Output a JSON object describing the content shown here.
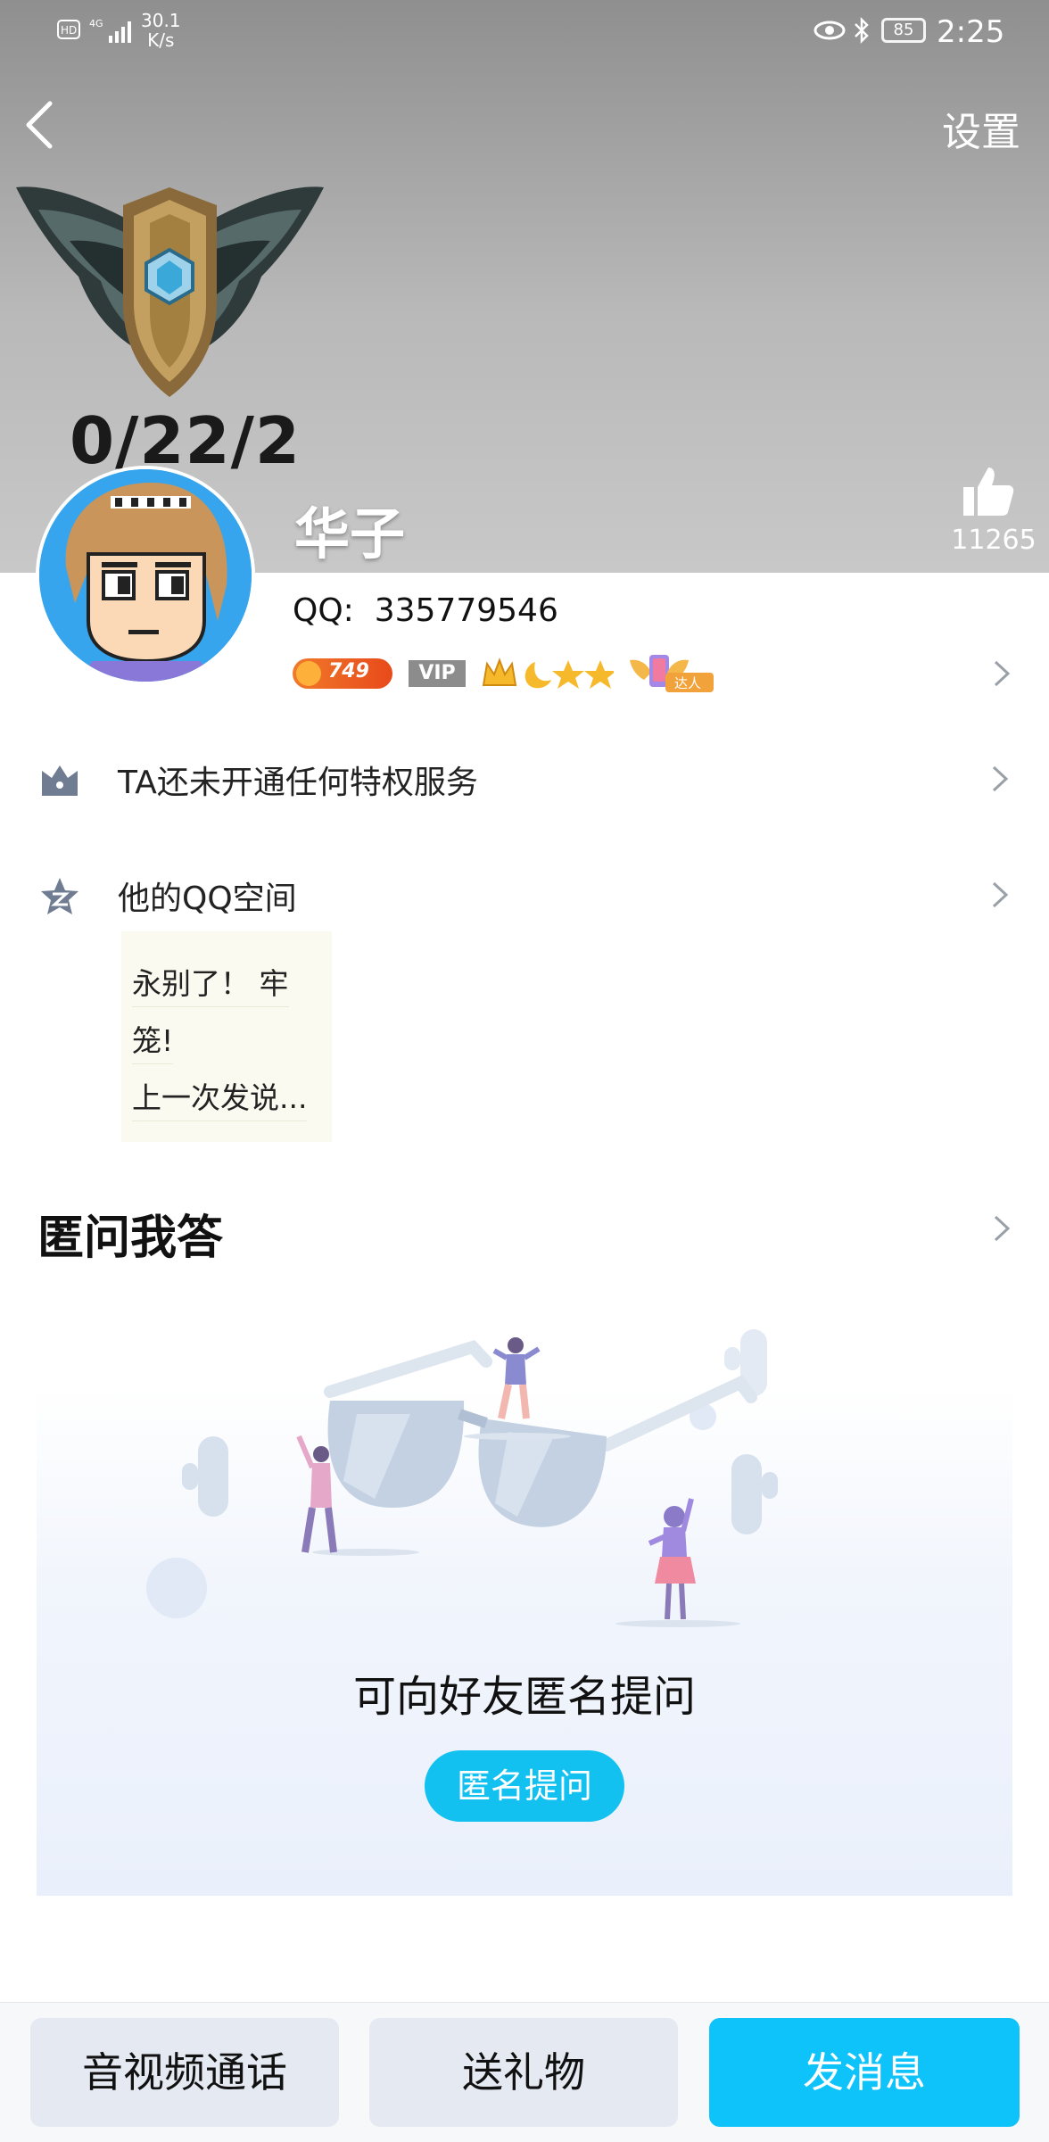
{
  "status_bar": {
    "network_speed_value": "30.1",
    "network_speed_unit": "K/s",
    "battery": "85",
    "time": "2:25",
    "left_icons": [
      "hd-icon",
      "4g-signal-icon"
    ],
    "right_icons": [
      "eye-icon",
      "bluetooth-icon",
      "battery-icon"
    ]
  },
  "header": {
    "settings_label": "设置",
    "game_stats": "0/22/2"
  },
  "profile": {
    "name": "华子",
    "likes": "11265",
    "qq_label": "QQ:",
    "qq_number": "335779546",
    "badges": {
      "level": "749",
      "vip": "VIP",
      "talent": "达人"
    }
  },
  "rows": {
    "privilege": "TA还未开通任何特权服务",
    "qzone": "他的QQ空间"
  },
  "qzone_post": {
    "line1": "永别了！ 牢",
    "line2": "笼!",
    "line3": "上一次发说..."
  },
  "anon_section": {
    "title": "匿问我答",
    "prompt": "可向好友匿名提问",
    "button": "匿名提问"
  },
  "bottom_bar": {
    "call": "音视频通话",
    "gift": "送礼物",
    "message": "发消息"
  },
  "colors": {
    "accent": "#0ec3f9",
    "button_gray": "#e5e9f2",
    "avatar_bg": "#37a5ee"
  }
}
